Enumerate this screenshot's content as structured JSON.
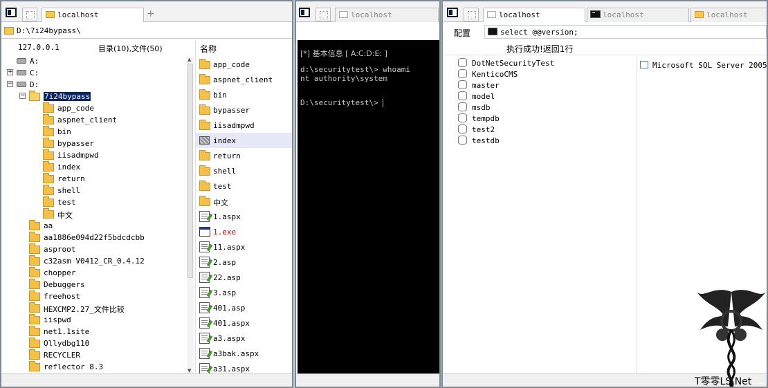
{
  "left": {
    "tab_label": "localhost",
    "address": "D:\\7i24bypass\\",
    "host": "127.0.0.1",
    "summary": "目录(10),文件(50)",
    "list_header": "名称",
    "drives": [
      "A:",
      "C:",
      "D:"
    ],
    "selected_folder": "7i24bypass",
    "subfolders": [
      "app_code",
      "aspnet_client",
      "bin",
      "bypasser",
      "iisadmpwd",
      "index",
      "return",
      "shell",
      "test",
      "中文"
    ],
    "d_folders": [
      "aa",
      "aa1886e094d22f5bdcdcbb",
      "asproot",
      "c32asm V0412_CR_0.4.12",
      "chopper",
      "Debuggers",
      "freehost",
      "HEXCMP2.27_文件比较",
      "iispwd",
      "net1.1site",
      "Ollydbg110",
      "RECYCLER",
      "reflector 8.3"
    ],
    "files": [
      {
        "name": "app_code",
        "type": "folder"
      },
      {
        "name": "aspnet_client",
        "type": "folder"
      },
      {
        "name": "bin",
        "type": "folder"
      },
      {
        "name": "bypasser",
        "type": "folder"
      },
      {
        "name": "iisadmpwd",
        "type": "folder"
      },
      {
        "name": "index",
        "type": "special"
      },
      {
        "name": "return",
        "type": "folder"
      },
      {
        "name": "shell",
        "type": "folder"
      },
      {
        "name": "test",
        "type": "folder"
      },
      {
        "name": "中文",
        "type": "folder"
      },
      {
        "name": "1.aspx",
        "type": "page"
      },
      {
        "name": "1.exe",
        "type": "exe"
      },
      {
        "name": "11.aspx",
        "type": "page"
      },
      {
        "name": "2.asp",
        "type": "page"
      },
      {
        "name": "22.asp",
        "type": "page"
      },
      {
        "name": "3.asp",
        "type": "page"
      },
      {
        "name": "401.asp",
        "type": "page"
      },
      {
        "name": "401.aspx",
        "type": "page"
      },
      {
        "name": "a3.aspx",
        "type": "page"
      },
      {
        "name": "a3bak.aspx",
        "type": "page"
      },
      {
        "name": "a31.aspx",
        "type": "page"
      }
    ],
    "highlighted_file": "index"
  },
  "middle": {
    "tab_label": "localhost",
    "lines": [
      "[*] 基本信息 [ A:C:D:E: ]",
      "d:\\securitytest\\> whoami",
      "nt authority\\system",
      "D:\\securitytest\\> "
    ]
  },
  "right": {
    "tabs": [
      "localhost",
      "localhost",
      "localhost"
    ],
    "config_label": "配置",
    "query": "select @@version;",
    "status": "执行成功!返回1行",
    "databases": [
      "DotNetSecurityTest",
      "KenticoCMS",
      "master",
      "model",
      "msdb",
      "tempdb",
      "test2",
      "testdb"
    ],
    "result": "Microsoft SQL Server 2005 -",
    "watermark": "T零零LS.Net"
  },
  "colors": {
    "selection": "#0a246a",
    "terminal_bg": "#000000",
    "exe_text": "#d60000",
    "folder": "#f5c04a"
  }
}
